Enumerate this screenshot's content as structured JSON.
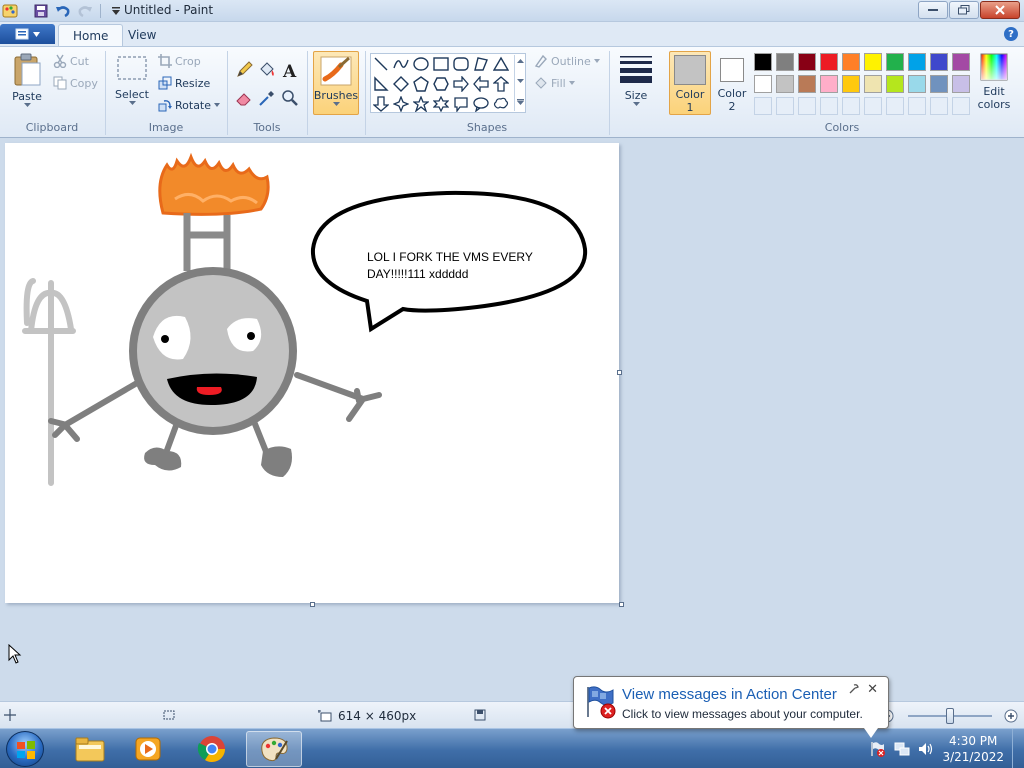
{
  "window": {
    "title": "Untitled - Paint"
  },
  "tabs": {
    "home": "Home",
    "view": "View"
  },
  "ribbon": {
    "clipboard": {
      "group": "Clipboard",
      "paste": "Paste",
      "cut": "Cut",
      "copy": "Copy"
    },
    "image": {
      "group": "Image",
      "select": "Select",
      "crop": "Crop",
      "resize": "Resize",
      "rotate": "Rotate"
    },
    "tools": {
      "group": "Tools"
    },
    "brushes": {
      "label": "Brushes"
    },
    "shapes": {
      "group": "Shapes",
      "outline": "Outline",
      "fill": "Fill"
    },
    "size": {
      "label": "Size"
    },
    "color1": {
      "line1": "Color",
      "line2": "1",
      "value": "#c3c3c3"
    },
    "color2": {
      "line1": "Color",
      "line2": "2",
      "value": "#ffffff"
    },
    "colors": {
      "group": "Colors",
      "edit_line1": "Edit",
      "edit_line2": "colors",
      "row1": [
        "#000000",
        "#7f7f7f",
        "#880015",
        "#ed1c24",
        "#ff7f27",
        "#fff200",
        "#22b14c",
        "#00a2e8",
        "#3f48cc",
        "#a349a4"
      ],
      "row2": [
        "#ffffff",
        "#c3c3c3",
        "#b97a57",
        "#ffaec9",
        "#ffc90e",
        "#efe4b0",
        "#b5e61d",
        "#99d9ea",
        "#7092be",
        "#c8bfe7"
      ]
    }
  },
  "canvas": {
    "speech": "LOL I FORK THE VMS EVERY DAY!!!!!111 xddddd"
  },
  "statusbar": {
    "dimensions": "614 × 460px"
  },
  "notification": {
    "title": "View messages in Action Center",
    "body": "Click to view messages about your computer."
  },
  "taskbar": {
    "time": "4:30 PM",
    "date": "3/21/2022"
  }
}
